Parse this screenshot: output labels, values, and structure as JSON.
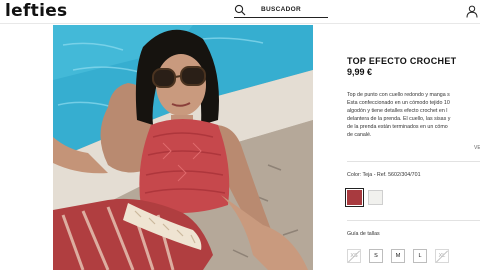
{
  "header": {
    "logo": "lefties",
    "search_placeholder": "BUSCADOR"
  },
  "product": {
    "title": "TOP EFECTO CROCHET",
    "price": "9,99 €",
    "description_lines": [
      "Top de punto con cuello redondo y manga s",
      "Esta confeccionado en un cómodo tejido 10",
      "algodón y tiene detalles efecto crochet en l",
      "delantera de la prenda. El cuello, las sisas y",
      "de la prenda están terminados en un cómo",
      "de canalé."
    ],
    "more_link": "VE",
    "color_label": "Color: Teja - Ref. 5602/304/701",
    "colors": [
      {
        "name": "Teja",
        "hex": "#a83a3f",
        "selected": true
      },
      {
        "name": "Crudo",
        "hex": "#f1f1ee",
        "selected": false
      }
    ],
    "size_guide": "Guía de tallas",
    "sizes": [
      {
        "label": "XS",
        "available": false
      },
      {
        "label": "S",
        "available": true
      },
      {
        "label": "M",
        "available": true
      },
      {
        "label": "L",
        "available": true
      },
      {
        "label": "XL",
        "available": false
      }
    ]
  },
  "colors": {
    "accent": "#a83a3f",
    "water": "#2fa9c9",
    "stone": "#b9ada1"
  }
}
